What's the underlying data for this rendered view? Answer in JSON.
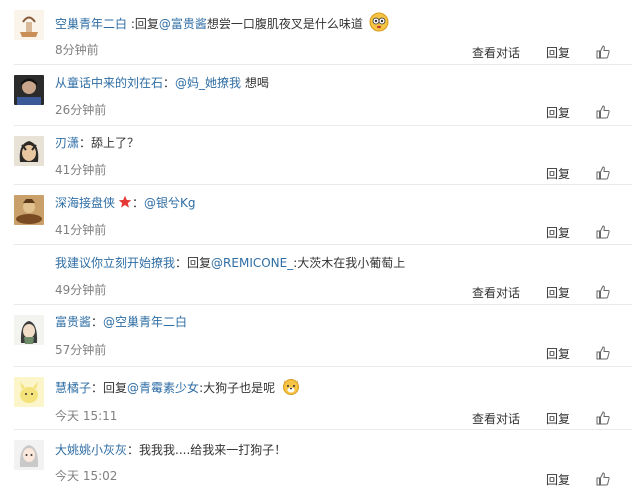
{
  "comments": [
    {
      "nick": "空巢青年二白",
      "has_reply": true,
      "reply_word": "回复",
      "mention": "@富贵酱",
      "colon": ":",
      "content": "想尝一口腹肌夜叉是什么味道",
      "emoji": "face-emoji",
      "time": "8分钟前",
      "actions": [
        "查看对话",
        "回复"
      ],
      "like_icon": "thumbs-up-icon"
    },
    {
      "nick": "从童话中来的刘在石",
      "colon": "：",
      "mention": "@妈_她撩我",
      "content": "想喝",
      "time": "26分钟前",
      "actions": [
        "回复"
      ],
      "like_icon": "thumbs-up-icon"
    },
    {
      "nick": "刃潇",
      "colon": "：",
      "content": "舔上了？",
      "time": "41分钟前",
      "actions": [
        "回复"
      ],
      "like_icon": "thumbs-up-icon"
    },
    {
      "nick": "深海接盘侠",
      "badge": "star-badge-icon",
      "colon": "：",
      "mention": "@银兮Kg",
      "time": "41分钟前",
      "actions": [
        "回复"
      ],
      "like_icon": "thumbs-up-icon"
    },
    {
      "nick": "我建议你立刻开始撩我",
      "colon": "：",
      "reply_word": "回复",
      "mention": "@REMICONE_",
      "content": ":大茨木在我小葡萄上",
      "time": "49分钟前",
      "actions": [
        "查看对话",
        "回复"
      ],
      "like_icon": "thumbs-up-icon"
    },
    {
      "nick": "富贵酱",
      "colon": "：",
      "mention": "@空巢青年二白",
      "time": "57分钟前",
      "actions": [
        "回复"
      ],
      "like_icon": "thumbs-up-icon"
    },
    {
      "nick": "慧橘子",
      "colon": "：",
      "reply_word": "回复",
      "mention": "@青霉素少女",
      "content": ":大狗子也是呢",
      "emoji": "dog-emoji",
      "time": "今天 15:11",
      "actions": [
        "查看对话",
        "回复"
      ],
      "like_icon": "thumbs-up-icon"
    },
    {
      "nick": "大姚姚小灰灰",
      "colon": "：",
      "content": "我我我....给我来一打狗子！",
      "time": "今天 15:02",
      "actions": [
        "回复"
      ],
      "like_icon": "thumbs-up-icon"
    }
  ],
  "colors": {
    "link": "#2e6da4",
    "text": "#333333",
    "time": "#808080",
    "divider": "#e9e9e9"
  }
}
